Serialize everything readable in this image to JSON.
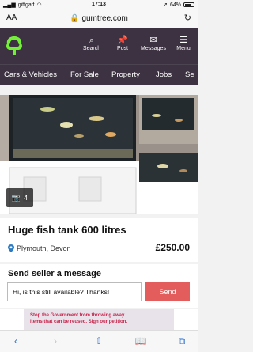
{
  "status": {
    "carrier": "giffgaff",
    "time": "17:13",
    "battery": "64%"
  },
  "browser": {
    "aa_label": "AA",
    "url": "gumtree.com"
  },
  "nav": {
    "search": "Search",
    "post": "Post",
    "messages": "Messages",
    "menu": "Menu"
  },
  "categories": [
    "Cars & Vehicles",
    "For Sale",
    "Property",
    "Jobs",
    "Se"
  ],
  "gallery": {
    "photo_count": "4"
  },
  "listing": {
    "title": "Huge fish tank 600 litres",
    "location": "Plymouth, Devon",
    "price": "£250.00"
  },
  "seller": {
    "heading": "Send seller a message",
    "message_value": "Hi, is this still available? Thanks!",
    "send_label": "Send"
  },
  "banner": {
    "text": "Stop the Government from throwing away items that can be reused. Sign our petition."
  },
  "colors": {
    "brand": "#3c3241",
    "accent": "#e35d5d",
    "logo_green": "#72ef36"
  }
}
